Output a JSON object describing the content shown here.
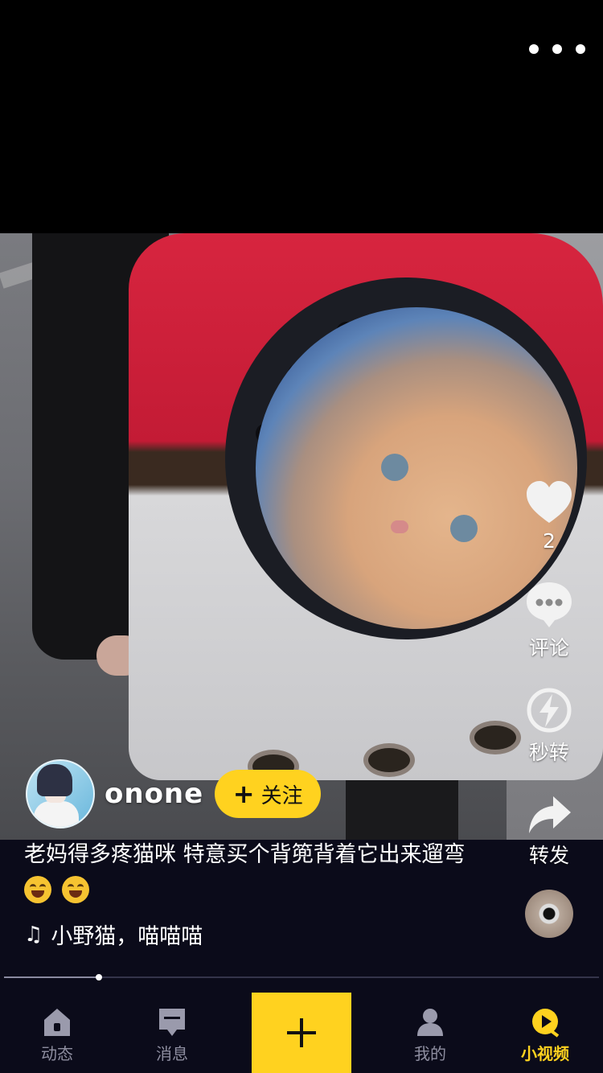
{
  "video": {
    "likes": "2",
    "comment_label": "评论",
    "flash_share_label": "秒转",
    "forward_label": "转发"
  },
  "author": {
    "username": "onone",
    "follow_label": "关注"
  },
  "caption": {
    "text": "老妈得多疼猫咪 特意买个背篼背着它出来遛弯"
  },
  "music": {
    "title": "小野猫，喵喵喵"
  },
  "progress": {
    "played_fraction": 0.16
  },
  "tabs": [
    {
      "label": "动态"
    },
    {
      "label": "消息"
    },
    {
      "label": "我的"
    },
    {
      "label": "小视频"
    }
  ],
  "colors": {
    "accent": "#ffd21f",
    "background": "#0b0b1a"
  }
}
